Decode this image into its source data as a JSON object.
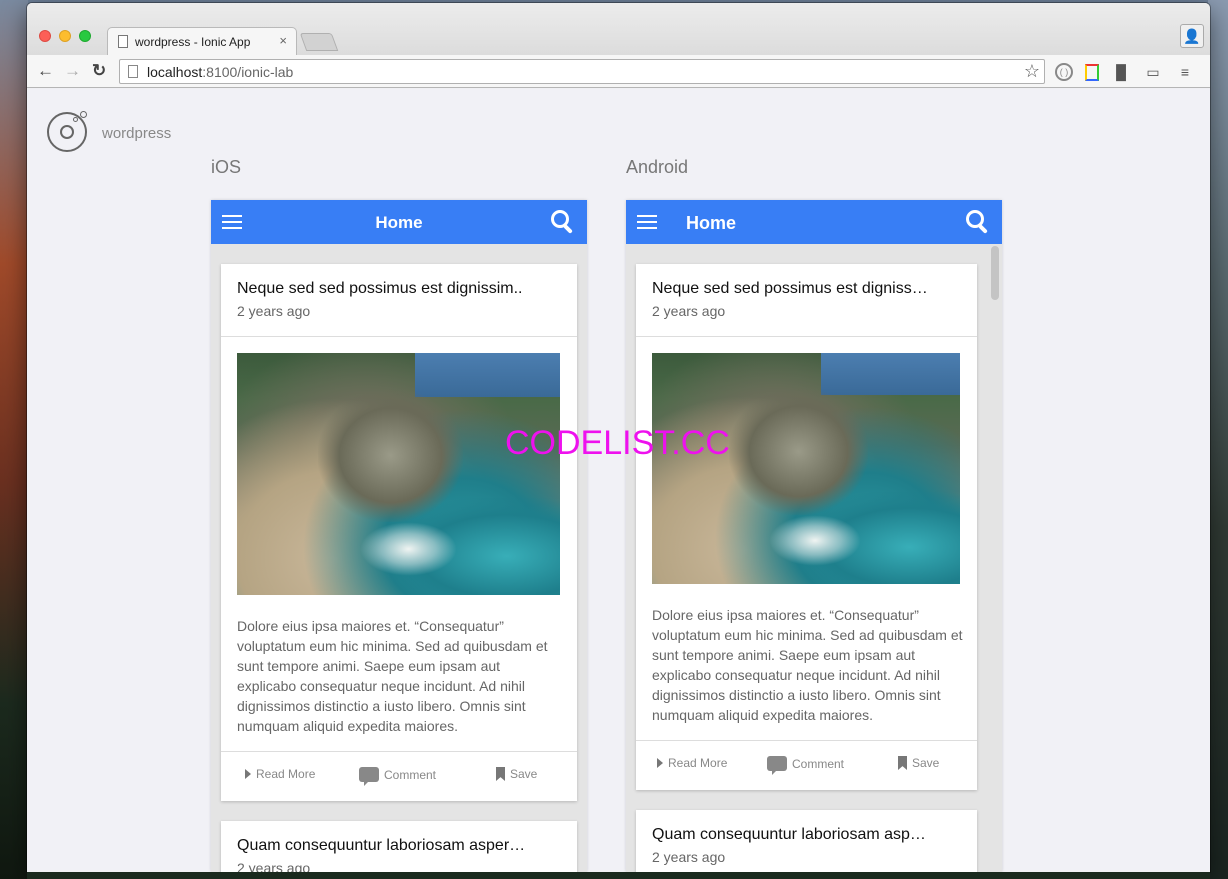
{
  "browser": {
    "tab_title": "wordpress - Ionic App",
    "tab_close": "×",
    "url_host": "localhost",
    "url_path": ":8100/ionic-lab"
  },
  "lab": {
    "app_name": "wordpress",
    "platforms": [
      "iOS",
      "Android"
    ]
  },
  "devices": {
    "ios": {
      "title": "Home",
      "cards": [
        {
          "title": "Neque sed sed possimus est dignissim..",
          "date": "2 years ago",
          "excerpt": "Dolore eius ipsa maiores et. “Consequatur” voluptatum eum hic minima. Sed ad quibusdam et sunt tempore animi. Saepe eum ipsam aut explicabo consequatur neque incidunt. Ad nihil dignissimos distinctio a iusto libero. Omnis sint numquam aliquid expedita maiores.",
          "actions": [
            "Read More",
            "Comment",
            "Save"
          ]
        },
        {
          "title": "Quam consequuntur laboriosam asper…",
          "date": "2 years ago"
        }
      ]
    },
    "android": {
      "title": "Home",
      "cards": [
        {
          "title": "Neque sed sed possimus est digniss…",
          "date": "2 years ago",
          "excerpt": "Dolore eius ipsa maiores et. “Consequatur” voluptatum eum hic minima. Sed ad quibusdam et sunt tempore animi. Saepe eum ipsam aut explicabo consequatur neque incidunt. Ad nihil dignissimos distinctio a iusto libero. Omnis sint numquam aliquid expedita maiores.",
          "actions": [
            "Read More",
            "Comment",
            "Save"
          ]
        },
        {
          "title": "Quam consequuntur laboriosam asp…",
          "date": "2 years ago"
        }
      ]
    }
  },
  "watermark": "CODELIST.CC",
  "colors": {
    "navbar": "#387ef5",
    "watermark": "#ee11ee"
  }
}
